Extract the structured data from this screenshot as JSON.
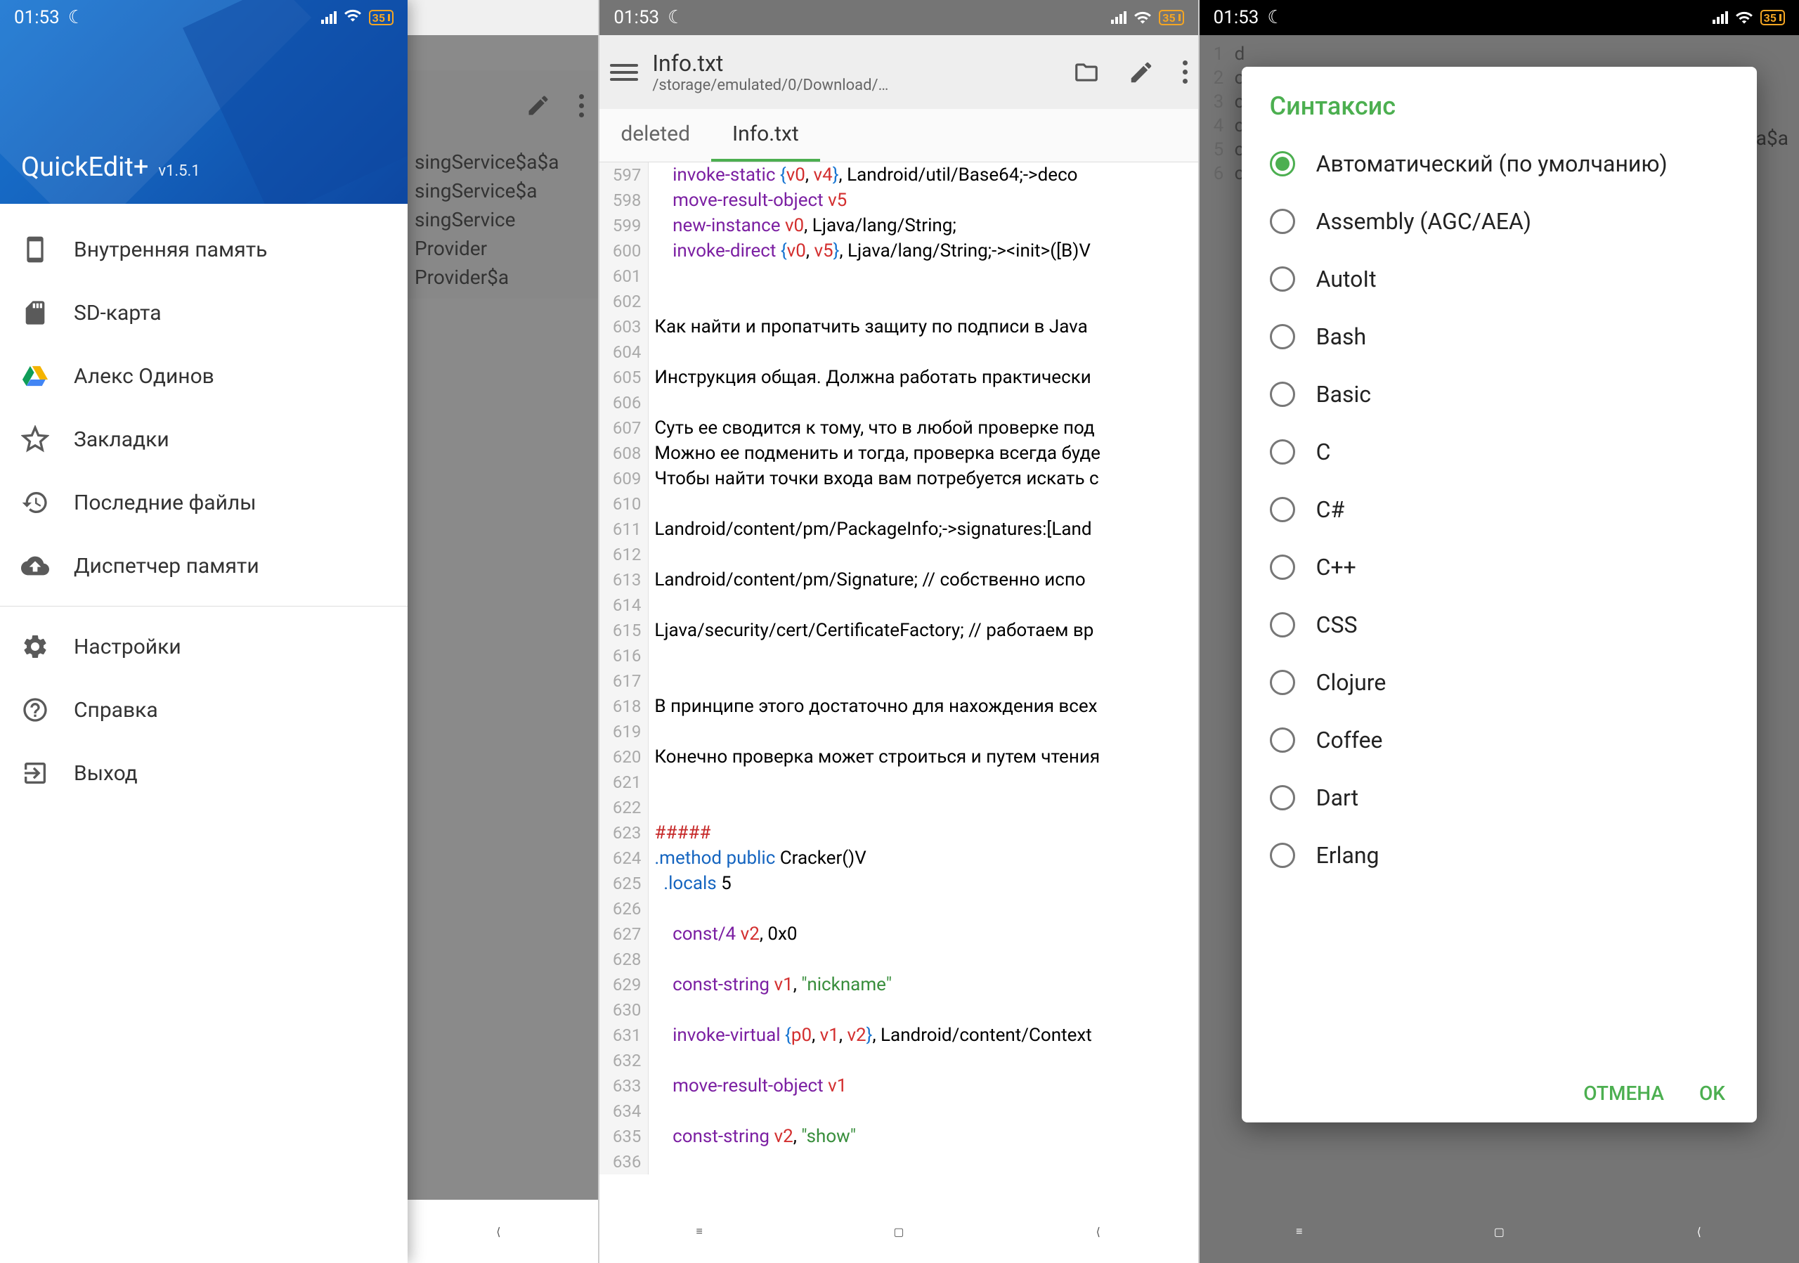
{
  "status": {
    "time": "01:53",
    "battery": "35"
  },
  "panel1": {
    "app_name": "QuickEdit+",
    "version": "v1.5.1",
    "drawer": {
      "internal_storage": "Внутренняя память",
      "sd_card": "SD-карта",
      "google_drive": "Алекс Одинов",
      "bookmarks": "Закладки",
      "recent_files": "Последние файлы",
      "storage_manager": "Диспетчер памяти",
      "settings": "Настройки",
      "help": "Справка",
      "exit": "Выход"
    },
    "bg_rows": [
      "singService$a$a",
      "singService$a",
      "singService",
      "Provider",
      "Provider$a"
    ]
  },
  "panel2": {
    "title": "Info.txt",
    "path": "/storage/emulated/0/Download/…",
    "tabs": {
      "deleted": "deleted",
      "info": "Info.txt"
    },
    "lines": [
      {
        "n": "597",
        "html": "&nbsp;&nbsp;&nbsp;&nbsp;<span class='kw'>invoke-static</span> <span class='brace'>{</span><span class='reg'>v0</span>, <span class='reg'>v4</span><span class='brace'>}</span>, Landroid/util/Base64;->deco"
      },
      {
        "n": "598",
        "html": "&nbsp;&nbsp;&nbsp;&nbsp;<span class='kw'>move-result-object</span> <span class='reg'>v5</span>"
      },
      {
        "n": "599",
        "html": "&nbsp;&nbsp;&nbsp;&nbsp;<span class='kw'>new-instance</span> <span class='reg'>v0</span>, Ljava/lang/String;"
      },
      {
        "n": "600",
        "html": "&nbsp;&nbsp;&nbsp;&nbsp;<span class='kw'>invoke-direct</span> <span class='brace'>{</span><span class='reg'>v0</span>, <span class='reg'>v5</span><span class='brace'>}</span>, Ljava/lang/String;-&gt;&lt;init&gt;([B)V"
      },
      {
        "n": "601",
        "html": ""
      },
      {
        "n": "602",
        "html": ""
      },
      {
        "n": "603",
        "html": "Как найти и пропатчить защиту по подписи в Java"
      },
      {
        "n": "604",
        "html": ""
      },
      {
        "n": "605",
        "html": "Инструкция общая. Должна работать практически"
      },
      {
        "n": "606",
        "html": ""
      },
      {
        "n": "607",
        "html": "Суть ее сводится к тому, что в любой проверке под"
      },
      {
        "n": "608",
        "html": "Можно ее подменить и тогда, проверка всегда буде"
      },
      {
        "n": "609",
        "html": "Чтобы найти точки входа вам потребуется искать с"
      },
      {
        "n": "610",
        "html": ""
      },
      {
        "n": "611",
        "html": "Landroid/content/pm/PackageInfo;->signatures:[Land"
      },
      {
        "n": "612",
        "html": ""
      },
      {
        "n": "613",
        "html": "Landroid/content/pm/Signature; // собственно испо"
      },
      {
        "n": "614",
        "html": ""
      },
      {
        "n": "615",
        "html": "Ljava/security/cert/CertificateFactory; // работаем вр"
      },
      {
        "n": "616",
        "html": ""
      },
      {
        "n": "617",
        "html": ""
      },
      {
        "n": "618",
        "html": "В принципе этого достаточно для нахождения всех"
      },
      {
        "n": "619",
        "html": ""
      },
      {
        "n": "620",
        "html": "Конечно проверка может строиться и путем чтения"
      },
      {
        "n": "621",
        "html": ""
      },
      {
        "n": "622",
        "html": ""
      },
      {
        "n": "623",
        "html": "<span class='hash'>#####</span>"
      },
      {
        "n": "624",
        "html": "<span class='dir'>.method public</span> Cracker()V"
      },
      {
        "n": "625",
        "html": "&nbsp;&nbsp;<span class='dir'>.locals</span> 5"
      },
      {
        "n": "626",
        "html": ""
      },
      {
        "n": "627",
        "html": "&nbsp;&nbsp;&nbsp;&nbsp;<span class='kw'>const/4</span> <span class='reg'>v2</span>, 0x0"
      },
      {
        "n": "628",
        "html": ""
      },
      {
        "n": "629",
        "html": "&nbsp;&nbsp;&nbsp;&nbsp;<span class='kw'>const-string</span> <span class='reg'>v1</span>, <span class='str'>\"nickname\"</span>"
      },
      {
        "n": "630",
        "html": ""
      },
      {
        "n": "631",
        "html": "&nbsp;&nbsp;&nbsp;&nbsp;<span class='kw'>invoke-virtual</span> <span class='brace'>{</span><span class='reg'>p0</span>, <span class='reg'>v1</span>, <span class='reg'>v2</span><span class='brace'>}</span>, Landroid/content/Context"
      },
      {
        "n": "632",
        "html": ""
      },
      {
        "n": "633",
        "html": "&nbsp;&nbsp;&nbsp;&nbsp;<span class='kw'>move-result-object</span> <span class='reg'>v1</span>"
      },
      {
        "n": "634",
        "html": ""
      },
      {
        "n": "635",
        "html": "&nbsp;&nbsp;&nbsp;&nbsp;<span class='kw'>const-string</span> <span class='reg'>v2</span>, <span class='str'>\"show\"</span>"
      },
      {
        "n": "636",
        "html": ""
      }
    ]
  },
  "panel3": {
    "dialog_title": "Синтаксис",
    "under_rows": [
      {
        "n": "1",
        "t": "d"
      },
      {
        "n": "2",
        "t": "c"
      },
      {
        "n": "3",
        "t": "c"
      },
      {
        "n": "4",
        "t": "c"
      },
      {
        "n": "5",
        "t": "c"
      },
      {
        "n": "6",
        "t": "c"
      }
    ],
    "options": [
      {
        "label": "Автоматический (по умолчанию)",
        "checked": true
      },
      {
        "label": "Assembly (AGC/AEA)",
        "checked": false
      },
      {
        "label": "AutoIt",
        "checked": false
      },
      {
        "label": "Bash",
        "checked": false
      },
      {
        "label": "Basic",
        "checked": false
      },
      {
        "label": "C",
        "checked": false
      },
      {
        "label": "C#",
        "checked": false
      },
      {
        "label": "C++",
        "checked": false
      },
      {
        "label": "CSS",
        "checked": false
      },
      {
        "label": "Clojure",
        "checked": false
      },
      {
        "label": "Coffee",
        "checked": false
      },
      {
        "label": "Dart",
        "checked": false
      },
      {
        "label": "Erlang",
        "checked": false
      }
    ],
    "cancel": "ОТМЕНА",
    "ok": "OK",
    "bg_peek": "$a$a"
  }
}
